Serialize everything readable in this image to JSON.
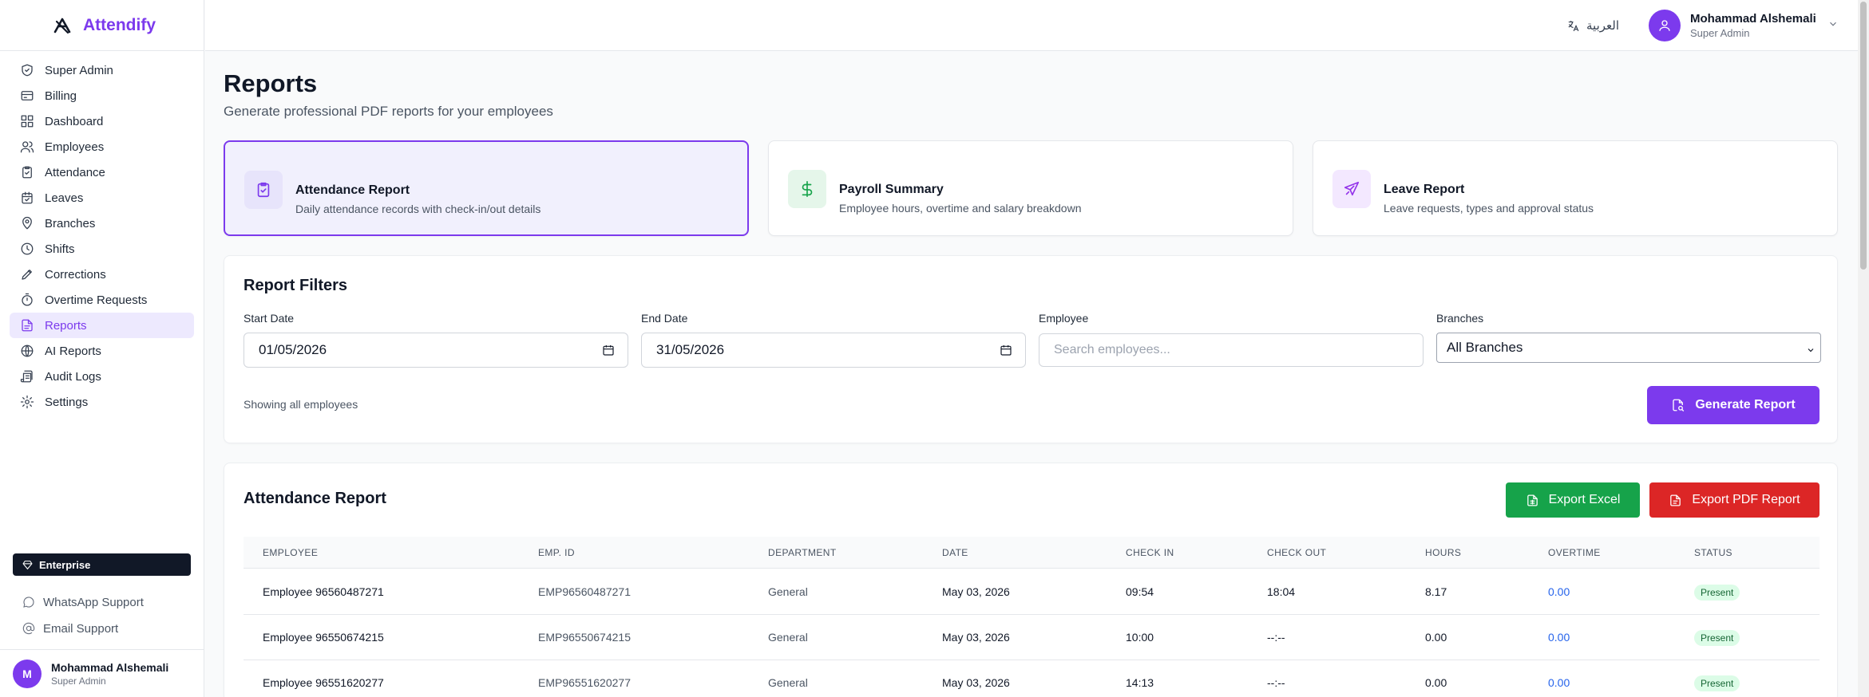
{
  "app": {
    "name": "Attendify"
  },
  "sidebar": {
    "items": [
      {
        "label": "Super Admin",
        "icon": "shield-icon"
      },
      {
        "label": "Billing",
        "icon": "credit-card-icon"
      },
      {
        "label": "Dashboard",
        "icon": "dashboard-icon"
      },
      {
        "label": "Employees",
        "icon": "users-icon"
      },
      {
        "label": "Attendance",
        "icon": "clipboard-check-icon"
      },
      {
        "label": "Leaves",
        "icon": "calendar-icon"
      },
      {
        "label": "Branches",
        "icon": "map-pin-icon"
      },
      {
        "label": "Shifts",
        "icon": "clock-icon"
      },
      {
        "label": "Corrections",
        "icon": "pen-icon"
      },
      {
        "label": "Overtime Requests",
        "icon": "timer-icon"
      },
      {
        "label": "Reports",
        "icon": "file-text-icon"
      },
      {
        "label": "AI Reports",
        "icon": "globe-icon"
      },
      {
        "label": "Audit Logs",
        "icon": "scroll-icon"
      },
      {
        "label": "Settings",
        "icon": "gear-icon"
      }
    ],
    "active_index": 10,
    "plan": "Enterprise",
    "whatsapp_support": "WhatsApp Support",
    "email_support": "Email Support",
    "user": {
      "initial": "M",
      "name": "Mohammad Alshemali",
      "role": "Super Admin"
    }
  },
  "header": {
    "language": "العربية",
    "user": {
      "name": "Mohammad Alshemali",
      "role": "Super Admin"
    }
  },
  "page": {
    "title": "Reports",
    "subtitle": "Generate professional PDF reports for your employees"
  },
  "report_types": [
    {
      "title": "Attendance Report",
      "description": "Daily attendance records with check-in/out details",
      "icon": "clipboard-check-icon",
      "color": "#7c3aed",
      "bg": "#e7e4fb",
      "selected": true
    },
    {
      "title": "Payroll Summary",
      "description": "Employee hours, overtime and salary breakdown",
      "icon": "dollar-icon",
      "color": "#16a34a",
      "bg": "#e5f6ea",
      "selected": false
    },
    {
      "title": "Leave Report",
      "description": "Leave requests, types and approval status",
      "icon": "plane-icon",
      "color": "#9333ea",
      "bg": "#f3e8ff",
      "selected": false
    }
  ],
  "filters": {
    "title": "Report Filters",
    "start_date_label": "Start Date",
    "start_date": "01/05/2026",
    "end_date_label": "End Date",
    "end_date": "31/05/2026",
    "employee_label": "Employee",
    "employee_placeholder": "Search employees...",
    "branches_label": "Branches",
    "branches_value": "All Branches",
    "showing": "Showing all employees",
    "generate_label": "Generate Report"
  },
  "report": {
    "title": "Attendance Report",
    "export_excel": "Export Excel",
    "export_pdf": "Export PDF Report",
    "columns": [
      "EMPLOYEE",
      "EMP. ID",
      "DEPARTMENT",
      "DATE",
      "CHECK IN",
      "CHECK OUT",
      "HOURS",
      "OVERTIME",
      "STATUS"
    ],
    "rows": [
      [
        "Employee 96560487271",
        "EMP96560487271",
        "General",
        "May 03, 2026",
        "09:54",
        "18:04",
        "8.17",
        "0.00",
        "Present"
      ],
      [
        "Employee 96550674215",
        "EMP96550674215",
        "General",
        "May 03, 2026",
        "10:00",
        "--:--",
        "0.00",
        "0.00",
        "Present"
      ],
      [
        "Employee 96551620277",
        "EMP96551620277",
        "General",
        "May 03, 2026",
        "14:13",
        "--:--",
        "0.00",
        "0.00",
        "Present"
      ]
    ]
  }
}
